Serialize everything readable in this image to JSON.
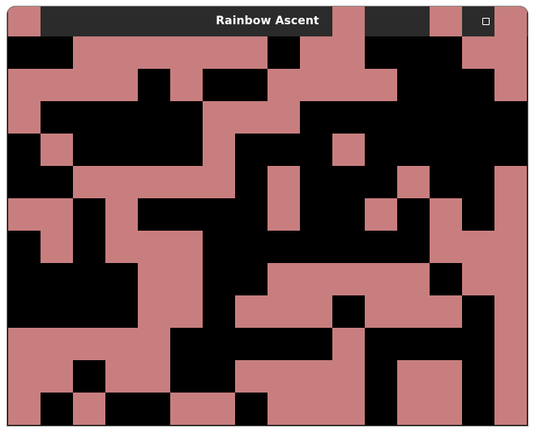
{
  "window": {
    "title": "Rainbow Ascent"
  },
  "controls": {
    "minimize_icon": "minimize-icon",
    "maximize_icon": "maximize-icon",
    "close_icon": "close-icon"
  },
  "colors": {
    "titlebar": "#2b2b2b",
    "title_text": "#ffffff",
    "close_button": "#e9541f",
    "wall": "#c87e7e",
    "background": "#000000"
  },
  "board": {
    "rows": [
      "1000000000100101",
      "0011111101100011",
      "1111010011110001",
      "1000001110000000",
      "0100001000100000",
      "0011111010001001",
      "1101000010010101",
      "0101110000000111",
      "0000110011111011",
      "0000110111011101",
      "1111100000100001",
      "1101100111101101",
      "1010011011101101"
    ]
  }
}
